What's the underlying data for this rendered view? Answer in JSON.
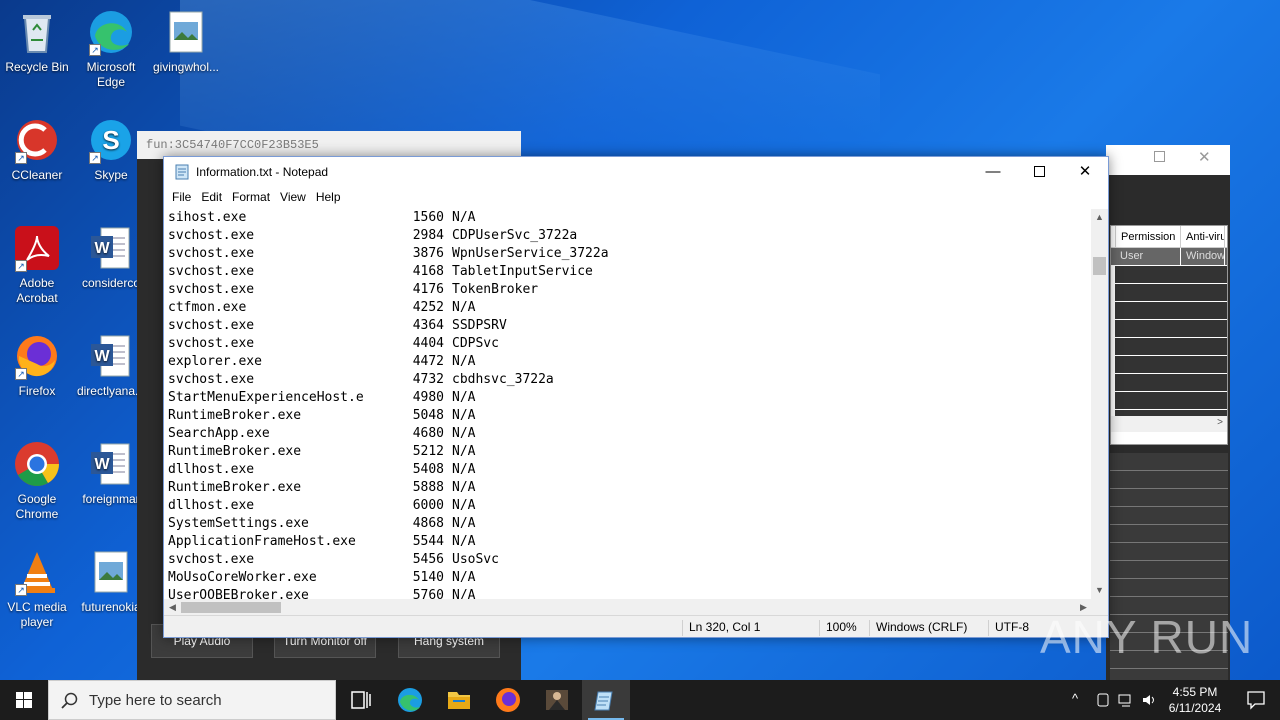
{
  "desktop": {
    "icons": [
      {
        "label": "Recycle Bin"
      },
      {
        "label": "Microsoft Edge"
      },
      {
        "label": "givingwhol..."
      },
      {
        "label": "CCleaner"
      },
      {
        "label": "Skype"
      },
      {
        "label": "Adobe Acrobat"
      },
      {
        "label": "considerco"
      },
      {
        "label": "Firefox"
      },
      {
        "label": "directlyana..."
      },
      {
        "label": "Google Chrome"
      },
      {
        "label": "foreignmar"
      },
      {
        "label": "VLC media player"
      },
      {
        "label": "futurenokia"
      }
    ]
  },
  "bg_window": {
    "title": "fun:3C54740F7CC0F23B53E5",
    "buttons": [
      "Play Audio",
      "Turn Monitor off",
      "Hang system"
    ]
  },
  "right_window": {
    "headers": [
      "Permission",
      "Anti-viru"
    ],
    "row": [
      "User",
      "Window"
    ]
  },
  "notepad": {
    "title": "Information.txt - Notepad",
    "menu": [
      "File",
      "Edit",
      "Format",
      "View",
      "Help"
    ],
    "lines": [
      [
        "sihost.exe",
        "1560",
        "N/A"
      ],
      [
        "svchost.exe",
        "2984",
        "CDPUserSvc_3722a"
      ],
      [
        "svchost.exe",
        "3876",
        "WpnUserService_3722a"
      ],
      [
        "svchost.exe",
        "4168",
        "TabletInputService"
      ],
      [
        "svchost.exe",
        "4176",
        "TokenBroker"
      ],
      [
        "ctfmon.exe",
        "4252",
        "N/A"
      ],
      [
        "svchost.exe",
        "4364",
        "SSDPSRV"
      ],
      [
        "svchost.exe",
        "4404",
        "CDPSvc"
      ],
      [
        "explorer.exe",
        "4472",
        "N/A"
      ],
      [
        "svchost.exe",
        "4732",
        "cbdhsvc_3722a"
      ],
      [
        "StartMenuExperienceHost.e",
        "4980",
        "N/A"
      ],
      [
        "RuntimeBroker.exe",
        "5048",
        "N/A"
      ],
      [
        "SearchApp.exe",
        "4680",
        "N/A"
      ],
      [
        "RuntimeBroker.exe",
        "5212",
        "N/A"
      ],
      [
        "dllhost.exe",
        "5408",
        "N/A"
      ],
      [
        "RuntimeBroker.exe",
        "5888",
        "N/A"
      ],
      [
        "dllhost.exe",
        "6000",
        "N/A"
      ],
      [
        "SystemSettings.exe",
        "4868",
        "N/A"
      ],
      [
        "ApplicationFrameHost.exe",
        "5544",
        "N/A"
      ],
      [
        "svchost.exe",
        "5456",
        "UsoSvc"
      ],
      [
        "MoUsoCoreWorker.exe",
        "5140",
        "N/A"
      ],
      [
        "UserOOBEBroker.exe",
        "5760",
        "N/A"
      ]
    ],
    "status": {
      "position": "Ln 320, Col 1",
      "zoom": "100%",
      "eol": "Windows (CRLF)",
      "encoding": "UTF-8"
    }
  },
  "watermark": "ANY RUN",
  "taskbar": {
    "search_placeholder": "Type here to search",
    "time": "4:55 PM",
    "date": "6/11/2024"
  }
}
